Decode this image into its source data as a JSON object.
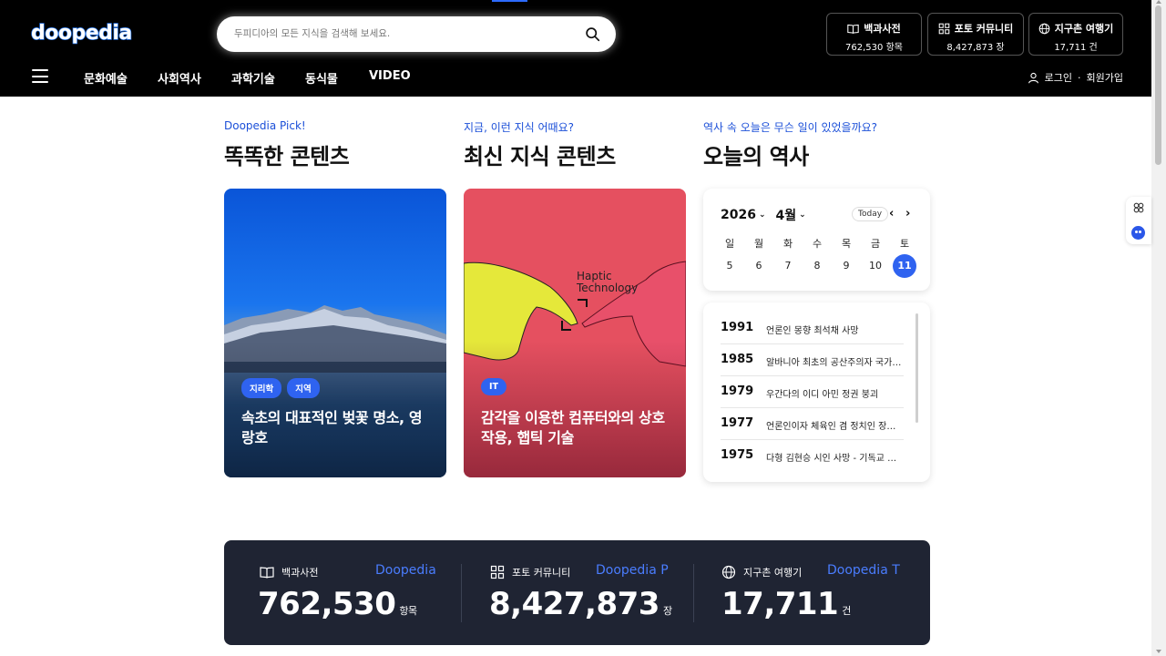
{
  "header": {
    "logo": "doopedia",
    "search_placeholder": "두피디아의 모든 지식을 검색해 보세요.",
    "stats": [
      {
        "title": "백과사전",
        "value": "762,530 항목",
        "icon": "book-icon"
      },
      {
        "title": "포토 커뮤니티",
        "value": "8,427,873 장",
        "icon": "grid-icon"
      },
      {
        "title": "지구촌 여행기",
        "value": "17,711 건",
        "icon": "globe-icon"
      }
    ]
  },
  "nav": {
    "items": [
      "문화예술",
      "사회역사",
      "과학기술",
      "동식물",
      "VIDEO"
    ],
    "login": "로그인",
    "separator": "·",
    "signup": "회원가입"
  },
  "sections": [
    {
      "sub": "Doopedia Pick!",
      "title": "똑똑한 콘텐츠"
    },
    {
      "sub": "지금, 이런 지식 어때요?",
      "title": "최신 지식 콘텐츠"
    },
    {
      "sub": "역사 속 오늘은 무슨 일이 있었을까요?",
      "title": "오늘의 역사"
    }
  ],
  "cards": [
    {
      "tags": [
        "지리학",
        "지역"
      ],
      "title": "속초의 대표적인 벚꽃 명소, 영랑호"
    },
    {
      "tags": [
        "IT"
      ],
      "title": "감각을 이용한 컴퓨터와의 상호작용, 햅틱 기술",
      "image_text": [
        "Haptic",
        "Technology"
      ]
    }
  ],
  "calendar": {
    "year": "2026",
    "month": "4월",
    "today_label": "Today",
    "weekdays": [
      "일",
      "월",
      "화",
      "수",
      "목",
      "금",
      "토"
    ],
    "days": [
      "5",
      "6",
      "7",
      "8",
      "9",
      "10",
      "11"
    ],
    "selected": "11"
  },
  "history": [
    {
      "year": "1991",
      "event": "언론인 몽향 최석채 사망"
    },
    {
      "year": "1985",
      "event": "알바니아 최초의 공산주의자 국가…"
    },
    {
      "year": "1979",
      "event": "우간다의 이디 아민 정권 붕괴"
    },
    {
      "year": "1977",
      "event": "언론인이자 체육인 겸 정치인 장기…"
    },
    {
      "year": "1975",
      "event": "다형 김현승 시인 사망 - 기독교 정…"
    }
  ],
  "bottom_stats": [
    {
      "label": "백과사전",
      "brand": "Doopedia",
      "number": "762,530",
      "unit": "항목",
      "icon": "book-icon"
    },
    {
      "label": "포토 커뮤니티",
      "brand": "Doopedia P",
      "number": "8,427,873",
      "unit": "장",
      "icon": "grid-icon"
    },
    {
      "label": "지구촌 여행기",
      "brand": "Doopedia T",
      "number": "17,711",
      "unit": "건",
      "icon": "globe-icon"
    }
  ],
  "colors": {
    "accent": "#2f63f0",
    "header_bg": "#000000",
    "stats_bg": "#1f2433",
    "brand_blue": "#4a7dff"
  }
}
